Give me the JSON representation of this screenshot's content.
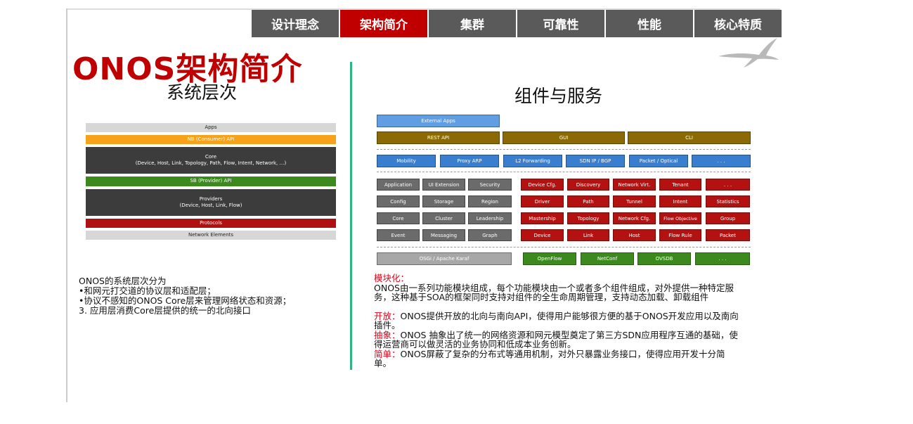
{
  "nav": {
    "tabs": [
      {
        "label": "设计理念",
        "active": false
      },
      {
        "label": "架构简介",
        "active": true
      },
      {
        "label": "集群",
        "active": false
      },
      {
        "label": "可靠性",
        "active": false
      },
      {
        "label": "性能",
        "active": false
      },
      {
        "label": "核心特质",
        "active": false
      }
    ]
  },
  "page": {
    "title": "ONOS架构简介",
    "left_subtitle": "系统层次",
    "right_subtitle": "组件与服务"
  },
  "layers": [
    {
      "text": "Apps",
      "style": "light"
    },
    {
      "text": "NB (Consumer) API",
      "style": "orange"
    },
    {
      "text": "Core\n(Device, Host, Link, Topology, Path, Flow, Intent, Network, …)",
      "style": "dark"
    },
    {
      "text": "SB (Provider) API",
      "style": "green"
    },
    {
      "text": "Providers\n(Device, Host, Link, Flow)",
      "style": "dark"
    },
    {
      "text": "Protocols",
      "style": "red"
    },
    {
      "text": "Network Elements",
      "style": "light"
    }
  ],
  "left_desc": [
    "ONOS的系统层次分为",
    "•和网元打交道的协议层和适配层；",
    "•协议不感知的ONOS Core层来管理网络状态和资源；",
    "3.    应用层消费Core层提供的统一的北向接口"
  ],
  "arch": {
    "external_apps": "External Apps",
    "row_api": [
      "REST API",
      "GUI",
      "CLI"
    ],
    "row_blue": [
      "Mobility",
      "Proxy ARP",
      "L2 Forwarding",
      "SDN IP / BGP",
      "Packet / Optical",
      ". . ."
    ],
    "gray_grid": [
      [
        "Application",
        "UI Extension",
        "Security"
      ],
      [
        "Config",
        "Storage",
        "Region"
      ],
      [
        "Core",
        "Cluster",
        "Leadership"
      ],
      [
        "Event",
        "Messaging",
        "Graph"
      ]
    ],
    "red_grid": [
      [
        "Device Cfg.",
        "Discovery",
        "Network Virt.",
        "Tenant",
        ". . ."
      ],
      [
        "Driver",
        "Path",
        "Tunnel",
        "Intent",
        "Statistics"
      ],
      [
        "Mastership",
        "Topology",
        "Network Cfg.",
        "Flow Objective",
        "Group"
      ],
      [
        "Device",
        "Link",
        "Host",
        "Flow Rule",
        "Packet"
      ]
    ],
    "osgi": "OSGi / Apache Karaf",
    "southbound": [
      "OpenFlow",
      "NetConf",
      "OVSDB",
      ". . ."
    ]
  },
  "right_desc": {
    "modular_label": "模块化：",
    "modular_text": "ONOS由一系列功能模块组成，每个功能模块由一个或者多个组件组成，对外提供一种特定服务，这种基于SOA的框架同时支持对组件的全生命周期管理，支持动态加载、卸载组件",
    "open_label": "开放：",
    "open_text": "ONOS提供开放的北向与南向API，使得用户能够很方便的基于ONOS开发应用以及南向插件。",
    "abstract_label": "抽象：",
    "abstract_text": "ONOS 抽象出了统一的网络资源和网元模型奠定了第三方SDN应用程序互通的基础，使得运营商可以做灵活的业务协同和低成本业务创新。",
    "simple_label": "简单：",
    "simple_text": "ONOS屏蔽了复杂的分布式等通用机制，对外只暴露业务接口，使得应用开发十分简单。"
  }
}
